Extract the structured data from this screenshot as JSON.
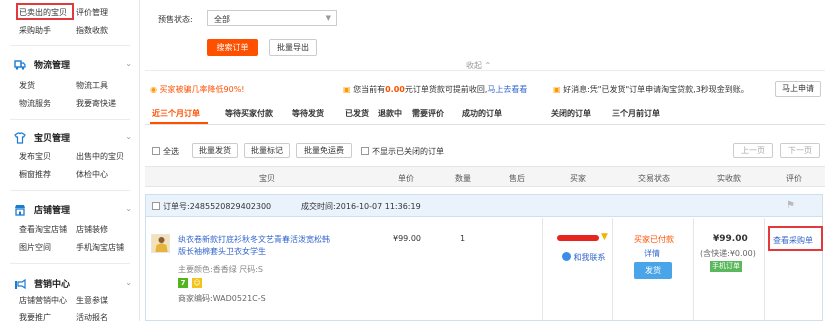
{
  "sidebar": {
    "top_links": {
      "sold": "已卖出的宝贝",
      "reviews": "评价管理",
      "purchase": "采购助手",
      "collect": "指数收款"
    },
    "logistics": {
      "title": "物流管理",
      "links": [
        "发货",
        "物流工具",
        "物流服务",
        "我要寄快递"
      ]
    },
    "goods": {
      "title": "宝贝管理",
      "links": [
        "发布宝贝",
        "出售中的宝贝",
        "橱窗推荐",
        "体检中心"
      ]
    },
    "shop": {
      "title": "店铺管理",
      "links": [
        "查看淘宝店铺",
        "店铺装修",
        "图片空间",
        "手机淘宝店铺"
      ]
    },
    "marketing": {
      "title": "营销中心",
      "links": [
        "店铺营销中心",
        "生意参谋",
        "我要推广",
        "活动报名"
      ]
    }
  },
  "filter": {
    "presale_label": "预售状态:",
    "presale_value": "全部",
    "search_button": "搜索订单",
    "export_button": "批量导出",
    "collapse": "收起"
  },
  "notices": {
    "n1": "买家被骗几率降低90%!",
    "n2_pre": "您当前有",
    "n2_amount": "0.00",
    "n2_post": "元订单货款可提前收回,",
    "n2_link": "马上去看看",
    "n3": "好消息:凭\"已发货\"订单申请淘宝贷款,3秒现金到账。",
    "n3_button": "马上申请"
  },
  "tabs": [
    "近三个月订单",
    "等待买家付款",
    "等待发货",
    "已发货",
    "退款中",
    "需要评价",
    "成功的订单",
    "关闭的订单",
    "三个月前订单"
  ],
  "toolbar": {
    "select_all": "全选",
    "batch_ship": "批量发货",
    "batch_mark": "批量标记",
    "batch_free": "批量免运费",
    "hide_closed": "不显示已关闭的订单",
    "prev": "上一页",
    "next": "下一页"
  },
  "columns": [
    "宝贝",
    "单价",
    "数量",
    "售后",
    "买家",
    "交易状态",
    "实收款",
    "评价"
  ],
  "order": {
    "order_no_label": "订单号:",
    "order_no": "2485520829402300",
    "time_label": "成交时间:",
    "time": "2016-10-07 11:36:19",
    "item_title": "纨衣卷新款打底衫秋冬文艺青春活泼宽松韩版长袖棉套头卫衣女学生",
    "item_attrs": "主要颜色:香香绿  尺码:S",
    "badge1": "7",
    "badge2": "☺",
    "merchant_code": "商家编码:WAD0521C-S",
    "price": "¥99.00",
    "quantity": "1",
    "buyer_contact": "和我联系",
    "status": "买家已付款",
    "detail": "详情",
    "ship_button": "发货",
    "total": "¥99.00",
    "shipping_note": "(含快递:¥0.00)",
    "mobile_tag": "手机订单",
    "view_purchase": "查看采购单"
  },
  "colors": {
    "accent": "#ff5000",
    "link": "#3366cc",
    "highlight": "#e4393c",
    "header_bg": "#f5f5f5",
    "order_bg": "#eaf2fc"
  }
}
